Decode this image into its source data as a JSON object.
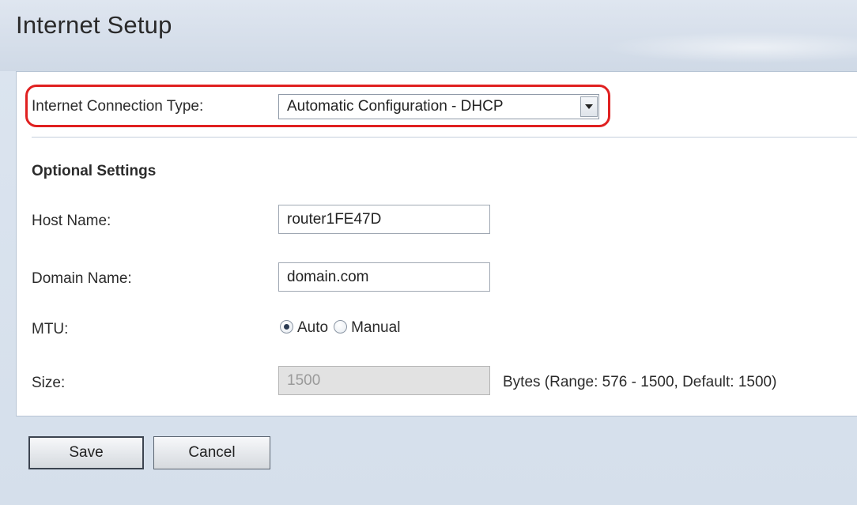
{
  "page": {
    "title": "Internet Setup"
  },
  "connection": {
    "label": "Internet Connection Type:",
    "selected": "Automatic Configuration - DHCP"
  },
  "optional": {
    "heading": "Optional Settings",
    "host_name": {
      "label": "Host Name:",
      "value": "router1FE47D"
    },
    "domain_name": {
      "label": "Domain Name:",
      "value": "domain.com"
    },
    "mtu": {
      "label": "MTU:",
      "options": [
        "Auto",
        "Manual"
      ],
      "selected": "Auto"
    },
    "size": {
      "label": "Size:",
      "value": "1500",
      "note": "Bytes (Range: 576 - 1500, Default: 1500)"
    }
  },
  "actions": {
    "save_label": "Save",
    "cancel_label": "Cancel"
  },
  "colors": {
    "highlight": "#e02020",
    "panel_bg": "#ffffff",
    "page_bg": "#d5dfeb"
  }
}
